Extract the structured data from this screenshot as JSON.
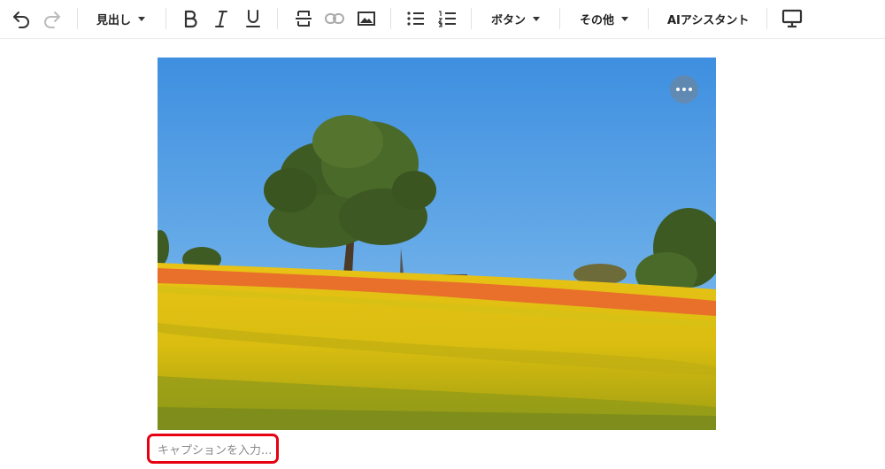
{
  "toolbar": {
    "undo_icon": "undo-icon",
    "redo_icon": "redo-icon",
    "heading_label": "見出し",
    "bold_icon": "bold-icon",
    "italic_icon": "italic-icon",
    "underline_icon": "underline-icon",
    "strikethrough_icon": "strikethrough-icon",
    "link_icon": "link-icon",
    "image_icon": "image-icon",
    "bullet_list_icon": "bullet-list-icon",
    "numbered_list_icon": "numbered-list-icon",
    "button_label": "ボタン",
    "more_label": "その他",
    "ai_assistant_label": "AIアシスタント",
    "preview_icon": "monitor-icon"
  },
  "image_block": {
    "menu_icon": "more-horizontal-icon",
    "caption_placeholder": "キャプションを入力..."
  },
  "colors": {
    "caption_highlight": "#e60012",
    "sky": "#4f9be3",
    "flowers_yellow": "#f2d21a",
    "flowers_orange": "#e8702a"
  }
}
